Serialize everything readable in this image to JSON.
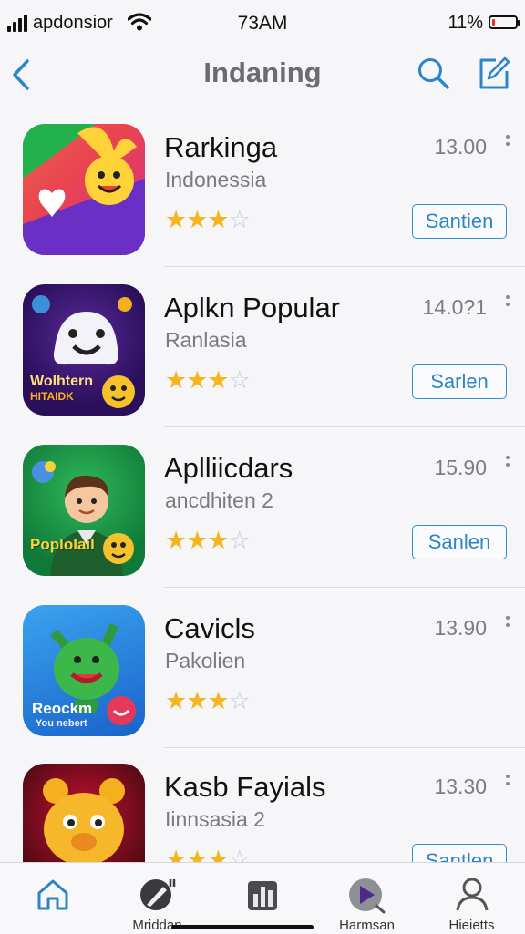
{
  "status": {
    "carrier": "apdonsior",
    "time": "73AM",
    "battery": "11%",
    "battery_level": 0.11
  },
  "nav": {
    "title": "Indaning",
    "back_icon": "chevron-left-icon",
    "search_icon": "search-icon",
    "compose_icon": "compose-icon"
  },
  "apps": [
    {
      "name": "Rarkinga",
      "subtitle": "Indonessia",
      "price": "13.00",
      "rating": 3.5,
      "button": "Santien"
    },
    {
      "name": "Aplkn Popular",
      "subtitle": "Ranlasia",
      "price": "14.0?1",
      "rating": 3.5,
      "button": "Sarlen",
      "icon_text": "Wolhtern",
      "icon_text2": "HITAIDK"
    },
    {
      "name": "Aplliicdars",
      "subtitle": "ancdhiten 2",
      "price": "15.90",
      "rating": 3.5,
      "button": "Sanlen",
      "icon_text": "Poplolail"
    },
    {
      "name": "Cavicls",
      "subtitle": "Pakolien",
      "price": "13.90",
      "rating": 3.5,
      "icon_text": "Reockm",
      "icon_text2": "You nebert"
    },
    {
      "name": "Kasb Fayials",
      "subtitle": "Iinnsasia 2",
      "price": "13.30",
      "rating": 3.5,
      "button": "Santlen"
    }
  ],
  "tabs": [
    {
      "label": "",
      "icon": "home-icon",
      "active": true
    },
    {
      "label": "Mriddan",
      "icon": "search-pen-icon"
    },
    {
      "label": "",
      "icon": "chart-icon"
    },
    {
      "label": "Harmsan",
      "icon": "play-icon"
    },
    {
      "label": "Hieietts",
      "icon": "person-icon"
    }
  ],
  "colors": {
    "accent": "#2a86c9",
    "star": "#f4b51e",
    "title": "#6b6b70"
  }
}
